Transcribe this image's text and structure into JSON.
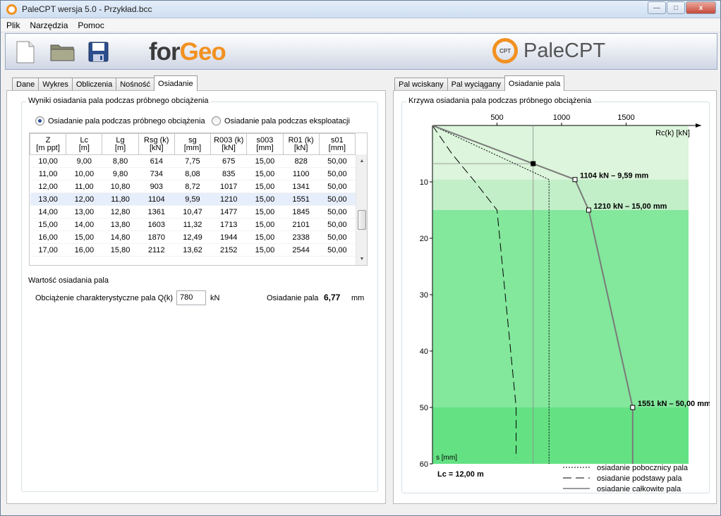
{
  "window": {
    "title": "PaleCPT wersja 5.0 - Przykład.bcc",
    "min": "—",
    "max": "□",
    "close": "x"
  },
  "menu": [
    "Plik",
    "Narzędzia",
    "Pomoc"
  ],
  "logos": {
    "forgeo_1": "for",
    "forgeo_2": "Geo",
    "palecpt": "PaleCPT",
    "ring_text": "CPT"
  },
  "left_tabs": [
    "Dane",
    "Wykres",
    "Obliczenia",
    "Nośność",
    "Osiadanie"
  ],
  "left_active": 4,
  "results": {
    "legend": "Wyniki osiadania pala podczas próbnego obciążenia",
    "radio1": "Osiadanie pala podczas próbnego obciążenia",
    "radio2": "Osiadanie pala podczas eksploatacji",
    "columns": [
      [
        "Z",
        "[m ppt]"
      ],
      [
        "Lc",
        "[m]"
      ],
      [
        "Lg",
        "[m]"
      ],
      [
        "Rsg (k)",
        "[kN]"
      ],
      [
        "sg",
        "[mm]"
      ],
      [
        "R003 (k)",
        "[kN]"
      ],
      [
        "s003",
        "[mm]"
      ],
      [
        "R01 (k)",
        "[kN]"
      ],
      [
        "s01",
        "[mm]"
      ]
    ],
    "rows": [
      [
        "10,00",
        "9,00",
        "8,80",
        "614",
        "7,75",
        "675",
        "15,00",
        "828",
        "50,00"
      ],
      [
        "11,00",
        "10,00",
        "9,80",
        "734",
        "8,08",
        "835",
        "15,00",
        "1100",
        "50,00"
      ],
      [
        "12,00",
        "11,00",
        "10,80",
        "903",
        "8,72",
        "1017",
        "15,00",
        "1341",
        "50,00"
      ],
      [
        "13,00",
        "12,00",
        "11,80",
        "1104",
        "9,59",
        "1210",
        "15,00",
        "1551",
        "50,00"
      ],
      [
        "14,00",
        "13,00",
        "12,80",
        "1361",
        "10,47",
        "1477",
        "15,00",
        "1845",
        "50,00"
      ],
      [
        "15,00",
        "14,00",
        "13,80",
        "1603",
        "11,32",
        "1713",
        "15,00",
        "2101",
        "50,00"
      ],
      [
        "16,00",
        "15,00",
        "14,80",
        "1870",
        "12,49",
        "1944",
        "15,00",
        "2338",
        "50,00"
      ],
      [
        "17,00",
        "16,00",
        "15,80",
        "2112",
        "13,62",
        "2152",
        "15,00",
        "2544",
        "50,00"
      ]
    ],
    "selected_row": 3,
    "value_label": "Wartość osiadania pala",
    "load_label": "Obciążenie charakterystyczne pala Q(k)",
    "load_value": "780",
    "load_unit": "kN",
    "settle_label": "Osiadanie pala",
    "settle_value": "6,77",
    "settle_unit": "mm"
  },
  "right_tabs": [
    "Pal wciskany",
    "Pal wyciągany",
    "Osiadanie pala"
  ],
  "right_active": 2,
  "chart_legend_title": "Krzywa osiadania pala podczas próbnego obciążenia",
  "chart_data": {
    "type": "line",
    "xlabel": "Rc(k) [kN]",
    "ylabel": "s [mm]",
    "xlim": [
      0,
      2000
    ],
    "ylim": [
      0,
      60
    ],
    "x_ticks": [
      500,
      1000,
      1500
    ],
    "y_ticks": [
      10,
      20,
      30,
      40,
      50,
      60
    ],
    "y_inverted": true,
    "series": [
      {
        "name": "osiadanie pobocznicy pala",
        "style": "dotted",
        "x": [
          0,
          903,
          903
        ],
        "y": [
          0,
          9.59,
          60
        ]
      },
      {
        "name": "osiadanie podstawy pala",
        "style": "dashed",
        "x": [
          0,
          150,
          330,
          500,
          648,
          648
        ],
        "y": [
          0,
          5,
          10,
          15,
          50,
          59
        ]
      },
      {
        "name": "osiadanie całkowite pala",
        "style": "solid",
        "x": [
          0,
          1104,
          1210,
          1551,
          1551
        ],
        "y": [
          0,
          9.59,
          15.0,
          50.0,
          60
        ]
      }
    ],
    "markers": [
      {
        "x": 780,
        "y": 6.77,
        "filled": true
      },
      {
        "x": 1104,
        "y": 9.59,
        "label": "1104 kN – 9,59 mm"
      },
      {
        "x": 1210,
        "y": 15.0,
        "label": "1210 kN – 15,00 mm"
      },
      {
        "x": 1551,
        "y": 50.0,
        "label": "1551 kN – 50,00 mm"
      }
    ],
    "bands_y": [
      [
        0,
        9.59
      ],
      [
        9.59,
        15
      ],
      [
        15,
        50
      ],
      [
        50,
        60
      ]
    ],
    "band_colors": [
      "#dcf5dc",
      "#c2efc8",
      "#83e79c",
      "#64e283"
    ],
    "annotation": "Lc =  12,00 m"
  }
}
